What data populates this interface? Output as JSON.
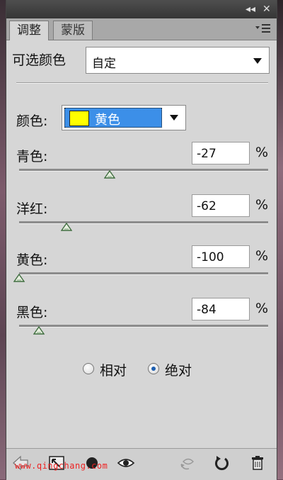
{
  "titlebar": {
    "collapse_icon": "double-chevron-left-icon",
    "close_icon": "close-icon",
    "collapse_glyph": "◂◂",
    "close_glyph": "✕"
  },
  "tabs": [
    {
      "label": "调整",
      "active": true
    },
    {
      "label": "蒙版",
      "active": false
    }
  ],
  "panel_menu_icon": "panel-menu-icon",
  "preset": {
    "label": "可选颜色",
    "value": "自定"
  },
  "colors": {
    "label": "颜色:",
    "value": "黄色",
    "swatch": "#ffff00"
  },
  "sliders": [
    {
      "label": "青色:",
      "value": "-27",
      "unit": "%",
      "level": -27
    },
    {
      "label": "洋红:",
      "value": "-62",
      "unit": "%",
      "level": -62
    },
    {
      "label": "黄色:",
      "value": "-100",
      "unit": "%",
      "level": -100
    },
    {
      "label": "黑色:",
      "value": "-84",
      "unit": "%",
      "level": -84
    }
  ],
  "method": {
    "relative": "相对",
    "absolute": "绝对",
    "selected": "absolute"
  },
  "bottom_icons": [
    "back-arrow-icon",
    "expand-view-icon",
    "clip-layer-icon",
    "visibility-eye-icon",
    "view-previous-icon",
    "reset-icon",
    "trash-icon"
  ],
  "watermark": "www.qingchang.com"
}
